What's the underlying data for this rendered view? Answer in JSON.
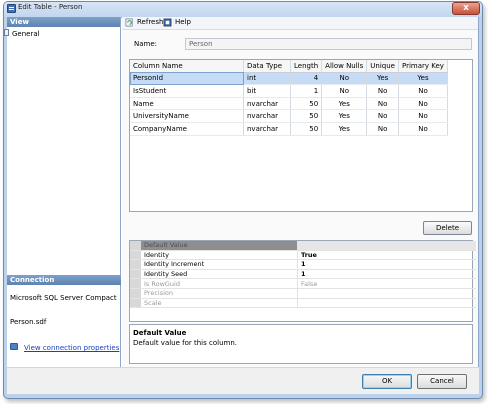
{
  "window": {
    "title": "Edit Table - Person",
    "close_glyph": "x"
  },
  "sidebar": {
    "view_header": "View",
    "nav_items": [
      {
        "label": "General"
      }
    ],
    "connection_header": "Connection",
    "connection_items": [
      {
        "label": "Microsoft SQL Server Compact"
      },
      {
        "label": "Person.sdf"
      }
    ],
    "view_link": "View connection properties"
  },
  "toolbar": {
    "refresh_label": "Refresh",
    "help_label": "Help"
  },
  "name_field": {
    "label": "Name:",
    "value": "Person"
  },
  "columns_grid": {
    "headers": [
      "Column Name",
      "Data Type",
      "Length",
      "Allow Nulls",
      "Unique",
      "Primary Key"
    ],
    "rows": [
      [
        "PersonId",
        "int",
        "4",
        "No",
        "Yes",
        "Yes"
      ],
      [
        "IsStudent",
        "bit",
        "1",
        "No",
        "No",
        "No"
      ],
      [
        "Name",
        "nvarchar",
        "50",
        "Yes",
        "No",
        "No"
      ],
      [
        "UniversityName",
        "nvarchar",
        "50",
        "Yes",
        "No",
        "No"
      ],
      [
        "CompanyName",
        "nvarchar",
        "50",
        "Yes",
        "No",
        "No"
      ]
    ]
  },
  "delete_label": "Delete",
  "properties": [
    {
      "name": "Default Value",
      "value": ""
    },
    {
      "name": "Identity",
      "value": "True"
    },
    {
      "name": "Identity Increment",
      "value": "1"
    },
    {
      "name": "Identity Seed",
      "value": "1"
    },
    {
      "name": "Is RowGuid",
      "value": "False"
    },
    {
      "name": "Precision",
      "value": ""
    },
    {
      "name": "Scale",
      "value": ""
    }
  ],
  "description": {
    "title": "Default Value",
    "text": "Default value for this column."
  },
  "footer": {
    "ok_label": "OK",
    "cancel_label": "Cancel"
  },
  "colors": {
    "accent": "#5e82b2",
    "selection": "#c6dcf6",
    "link": "#1a3fbf"
  }
}
